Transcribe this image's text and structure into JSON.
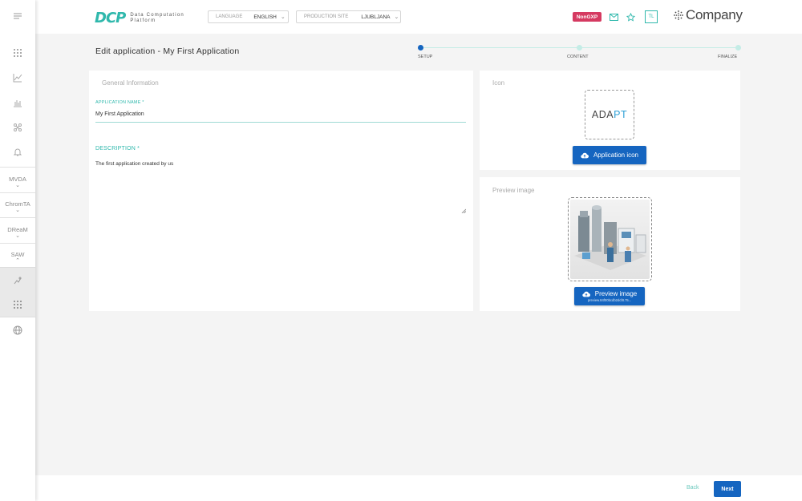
{
  "sidebar": {
    "sections": [
      "MVDA",
      "ChromTA",
      "DReaM",
      "SAW"
    ]
  },
  "header": {
    "logo_mark": "DCP",
    "logo_line1": "Data Computation",
    "logo_line2": "Platform",
    "language_label": "LANGUAGE",
    "language_value": "ENGLISH",
    "site_label": "PRODUCTION SITE",
    "site_value": "LJUBLJANA",
    "badge": "NonGXP",
    "user_initials": "TL",
    "company": "Company"
  },
  "page": {
    "title": "Edit application - My First Application"
  },
  "stepper": {
    "steps": [
      "SETUP",
      "CONTENT",
      "FINALIZE"
    ],
    "active_index": 0
  },
  "general": {
    "title": "General Information",
    "name_label": "APPLICATION NAME *",
    "name_value": "My First Application",
    "desc_label": "DESCRIPTION *",
    "desc_value": "The first application created by us"
  },
  "icon_card": {
    "title": "Icon",
    "logo_text_a": "ADA",
    "logo_text_b": "PT",
    "button": "Application icon"
  },
  "preview_card": {
    "title": "Preview image",
    "button": "Preview image",
    "filename": "preview.84f00bcdb2dcf8.75..."
  },
  "footer": {
    "back": "Back",
    "next": "Next"
  },
  "colors": {
    "accent": "#2fb8ac",
    "primary": "#1565c0",
    "badge": "#d53a61"
  }
}
